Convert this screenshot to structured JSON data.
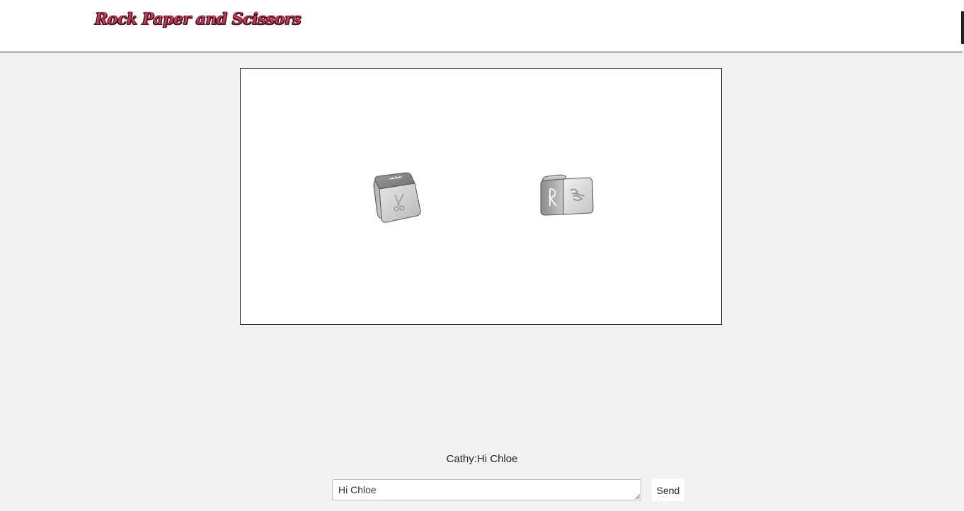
{
  "header": {
    "logo_text": "Rock Paper and Scissors"
  },
  "game": {
    "dice": [
      {
        "name": "left-die",
        "top_symbol": "paper",
        "front_symbol": "scissors"
      },
      {
        "name": "right-die",
        "front_symbol": "R",
        "side_symbol": "scissors"
      }
    ]
  },
  "chat": {
    "last_message": "Cathy:Hi Chloe",
    "input_value": "Hi Chloe",
    "send_label": "Send"
  },
  "colors": {
    "logo_fill": "#c63a5c",
    "page_background": "#f2f2f2"
  }
}
